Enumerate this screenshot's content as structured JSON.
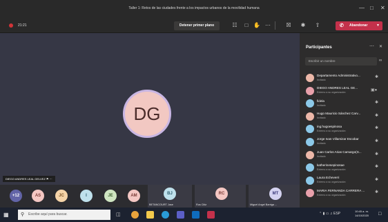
{
  "window": {
    "title": "Taller 1: Retos de las ciudades frente a los impactos urbanos de la movilidad humana",
    "minimize_icon": "minimize-icon",
    "maximize_icon": "maximize-icon",
    "close_icon": "close-icon"
  },
  "toolbar": {
    "timer": "21:21",
    "stop_pin_label": "Detener primer plano",
    "leave_label": "Abandonar",
    "colors": {
      "leave": "#c4314b",
      "record": "#d13438"
    }
  },
  "stage": {
    "main_initials": "DG",
    "speaker_name": "DIEGO ANDRES LEAL GELVEZ"
  },
  "gallery": {
    "overflow_count": "+12",
    "chips": [
      {
        "initials": "AS",
        "bg": "#f4c7c3",
        "fg": "#7a3b36"
      },
      {
        "initials": "JC",
        "bg": "#f6d4a8",
        "fg": "#7a5224"
      },
      {
        "initials": "I",
        "bg": "#bfe1ec",
        "fg": "#2f5f70"
      },
      {
        "initials": "JE",
        "bg": "#cfe5c1",
        "fg": "#3d6030"
      },
      {
        "initials": "AM",
        "bg": "#f4c7c3",
        "fg": "#7a3b36"
      }
    ],
    "tiles": [
      {
        "initials": "BJ",
        "name": "BETANCOURT Jose"
      },
      {
        "initials": "RC",
        "name": "Rus Citiz"
      },
      {
        "initials": "MT",
        "name": "Miguel Angel Barriga ..."
      }
    ]
  },
  "sidebar": {
    "title": "Participantes",
    "search_placeholder": "Escribir un nombre",
    "participants": [
      {
        "name": "Departamento Administrativo...",
        "status": "Invitado"
      },
      {
        "name": "DIEGO ANDRES LEAL GE...",
        "status": "Externo a su organización"
      },
      {
        "name": "fidela",
        "status": "Invitado"
      },
      {
        "name": "Hugo Mauricio Sánchez Carv...",
        "status": "Invitado"
      },
      {
        "name": "ing.hugoespinosa",
        "status": "Externo a su organización"
      },
      {
        "name": "Jorge Ivan Villamizar Escobar",
        "status": "Invitado"
      },
      {
        "name": "Juan Carlos Arias Camargo(S...",
        "status": "Invitado"
      },
      {
        "name": "katherinesepinosae",
        "status": "Externo a su organización"
      },
      {
        "name": "Laura Echeverri",
        "status": "Externo a su organización"
      },
      {
        "name": "MARIA FERNANDA CARRERA ...",
        "status": "Externo a su organización"
      }
    ]
  },
  "taskbar": {
    "search_placeholder": "Escribe aquí para buscar.",
    "language": "ESP",
    "time": "10:45 a. m.",
    "date": "14/10/2020"
  }
}
